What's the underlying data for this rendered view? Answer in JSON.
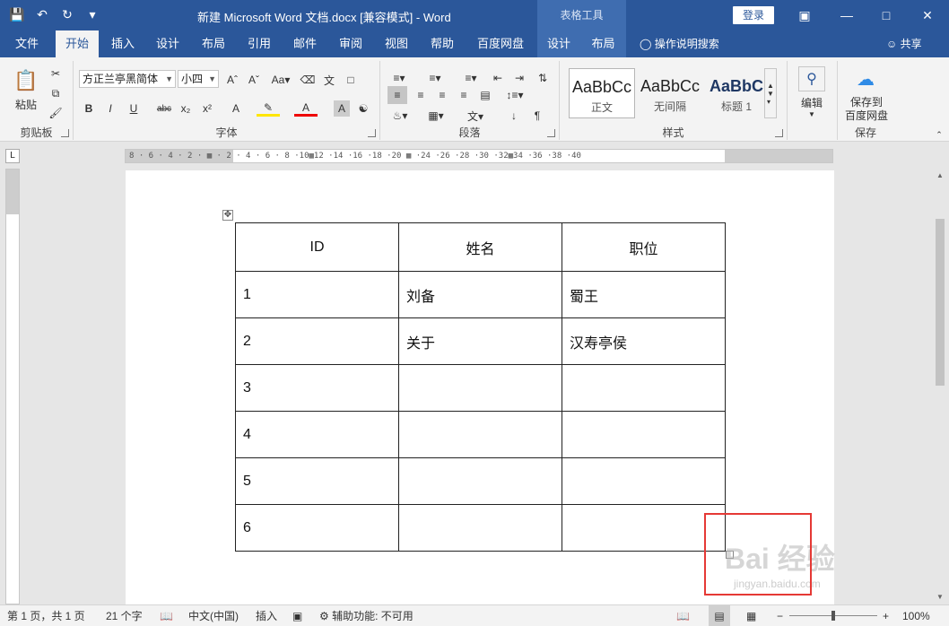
{
  "titlebar": {
    "title": "新建 Microsoft Word 文档.docx [兼容模式]  -  Word",
    "context_header": "表格工具",
    "login_label": "登录",
    "qat_icons": [
      "save-icon",
      "undo-icon",
      "redo-icon",
      "customize-icon"
    ]
  },
  "tabs": {
    "file": "文件",
    "home": "开始",
    "insert": "插入",
    "design": "设计",
    "layout": "布局",
    "references": "引用",
    "mailings": "邮件",
    "review": "审阅",
    "view": "视图",
    "help": "帮助",
    "baidu": "百度网盘",
    "table_design": "设计",
    "table_layout": "布局",
    "tell_me": "操作说明搜索",
    "share": "共享"
  },
  "ribbon": {
    "clipboard": {
      "label": "剪贴板",
      "paste": "粘贴"
    },
    "font": {
      "label": "字体",
      "font_name": "方正兰亭黑简体",
      "font_size": "小四"
    },
    "paragraph": {
      "label": "段落"
    },
    "styles": {
      "label": "样式",
      "items": [
        {
          "sample": "AaBbCc",
          "name": "正文"
        },
        {
          "sample": "AaBbCc",
          "name": "无间隔"
        },
        {
          "sample": "AaBbC",
          "name": "标题 1"
        }
      ]
    },
    "editing": {
      "label": "编辑"
    },
    "save": {
      "label": "保存",
      "button": "保存到\n百度网盘"
    }
  },
  "table": {
    "headers": [
      "ID",
      "姓名",
      "职位"
    ],
    "rows": [
      [
        "1",
        "刘备",
        "蜀王"
      ],
      [
        "2",
        "关于",
        "汉寿亭侯"
      ],
      [
        "3",
        "",
        ""
      ],
      [
        "4",
        "",
        ""
      ],
      [
        "5",
        "",
        ""
      ],
      [
        "6",
        "",
        ""
      ]
    ]
  },
  "statusbar": {
    "page": "第 1 页，共 1 页",
    "words": "21 个字",
    "language": "中文(中国)",
    "mode": "插入",
    "accessibility": "辅助功能: 不可用",
    "zoom": "100%"
  },
  "watermark": {
    "text": "Bai 经验",
    "sub": "jingyan.baidu.com"
  },
  "colors": {
    "accent": "#2b579a",
    "highlight": "#e53935"
  }
}
